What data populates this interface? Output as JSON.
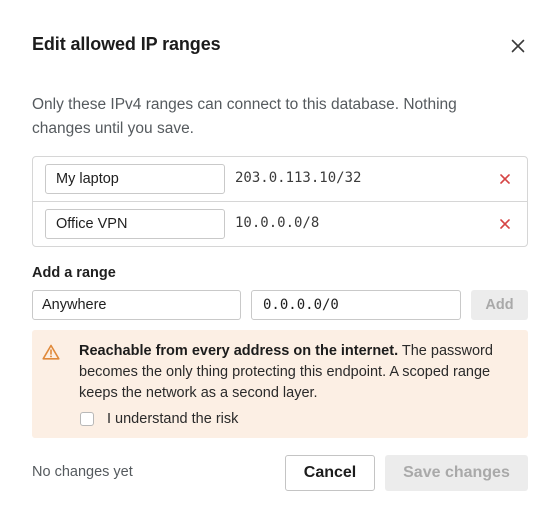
{
  "dialog": {
    "title": "Edit allowed IP ranges",
    "description": "Only these IPv4 ranges can connect to this database. Nothing changes until you save.",
    "close_icon": "close-icon"
  },
  "ranges": [
    {
      "name": "My laptop",
      "cidr": "203.0.113.10/32",
      "remove_icon": "remove-x-icon"
    },
    {
      "name": "Office VPN",
      "cidr": "10.0.0.0/8",
      "remove_icon": "remove-x-icon"
    }
  ],
  "add_range": {
    "label": "Add a range",
    "name_value": "Anywhere",
    "cidr_value": "0.0.0.0/0",
    "button_label": "Add"
  },
  "warning": {
    "icon": "warning-triangle-icon",
    "title": "Reachable from every address on the internet.",
    "body": " The password becomes the only thing protecting this endpoint. A scoped range keeps the network as a second layer.",
    "checkbox_label": "I understand the risk",
    "checkbox_checked": false
  },
  "footer": {
    "status": "No changes yet",
    "cancel_label": "Cancel",
    "save_label": "Save changes"
  },
  "colors": {
    "danger": "#d64545",
    "warning_bg": "#fcefe4",
    "warning_icon": "#e0893a",
    "disabled_bg": "#ececec",
    "disabled_text": "#a9a9a9"
  }
}
